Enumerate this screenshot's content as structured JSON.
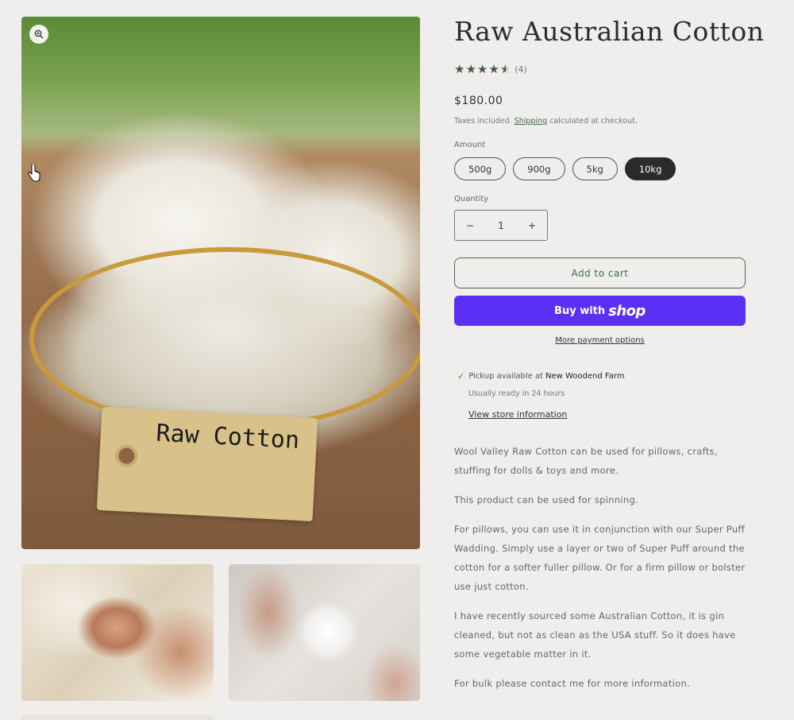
{
  "product": {
    "title": "Raw Australian Cotton",
    "rating_count": "(4)",
    "price": "$180.00",
    "tax_prefix": "Taxes included.",
    "tax_link": "Shipping",
    "tax_suffix": "calculated at checkout.",
    "image_tag_text": "Raw Cotton"
  },
  "rating": {
    "value": 4.5,
    "max": 5
  },
  "variant": {
    "label": "Amount",
    "options": [
      "500g",
      "900g",
      "5kg",
      "10kg"
    ],
    "selected": "10kg"
  },
  "quantity": {
    "label": "Quantity",
    "value": "1",
    "decrement": "−",
    "increment": "+"
  },
  "buttons": {
    "add_to_cart": "Add to cart",
    "buy_with": "Buy with",
    "buy_brand": "shop",
    "more_payment": "More payment options"
  },
  "pickup": {
    "text": "Pickup available at",
    "location": "New Woodend Farm",
    "ready": "Usually ready in 24 hours",
    "store_link": "View store information"
  },
  "description": [
    "Wool Valley Raw Cotton can be used for pillows, crafts, stuffing for dolls & toys and more.",
    "This product can be used for spinning.",
    "For pillows, you can use it in conjunction with our Super Puff Wadding. Simply use a layer or two of Super Puff around the cotton for a softer fuller pillow. Or for a firm pillow or bolster use just cotton.",
    "I have recently sourced some Australian Cotton, it is gin cleaned, but not as clean as the USA stuff. So it does have some vegetable matter in it.",
    "For bulk please contact me for more information."
  ],
  "colors": {
    "accent_green": "#3d6b4c",
    "star": "#3d5a48",
    "shop_pay": "#5a31f4",
    "selected_pill": "#2b2b2b",
    "background": "#efeeec"
  },
  "icons": [
    "zoom-icon",
    "cursor-icon",
    "star-icon",
    "checkmark-icon"
  ]
}
